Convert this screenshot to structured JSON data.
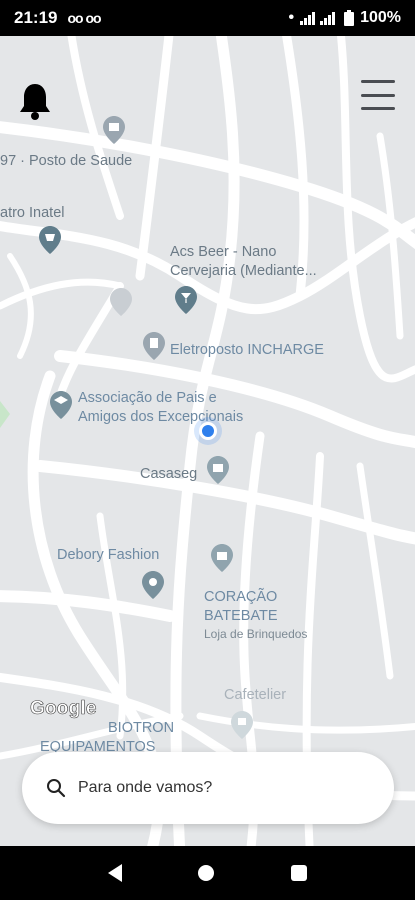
{
  "status_bar": {
    "time": "21:19",
    "voicemail_icons": "oo oo",
    "battery": "100%"
  },
  "map": {
    "pois": [
      {
        "key": "posto",
        "label": "97 · Posto de Saude"
      },
      {
        "key": "teatro",
        "label": "atro Inatel"
      },
      {
        "key": "acs1",
        "label": "Acs Beer - Nano"
      },
      {
        "key": "acs2",
        "label": "Cervejaria (Mediante..."
      },
      {
        "key": "eletro",
        "label": "Eletroposto INCHARGE"
      },
      {
        "key": "assoc1",
        "label": "Associação de Pais e"
      },
      {
        "key": "assoc2",
        "label": "Amigos dos Excepcionais"
      },
      {
        "key": "casaseg",
        "label": "Casaseg"
      },
      {
        "key": "debory",
        "label": "Debory Fashion"
      },
      {
        "key": "coracao1",
        "label": "CORAÇÃO"
      },
      {
        "key": "coracao2",
        "label": "BATEBATE"
      },
      {
        "key": "coracao3",
        "label": "Loja de Brinquedos"
      },
      {
        "key": "cafe",
        "label": "Cafetelier"
      },
      {
        "key": "biotron1",
        "label": "BIOTRON"
      },
      {
        "key": "biotron2",
        "label": "EQUIPAMENTOS"
      }
    ],
    "google_logo": "Google"
  },
  "search": {
    "placeholder": "Para onde vamos?"
  }
}
